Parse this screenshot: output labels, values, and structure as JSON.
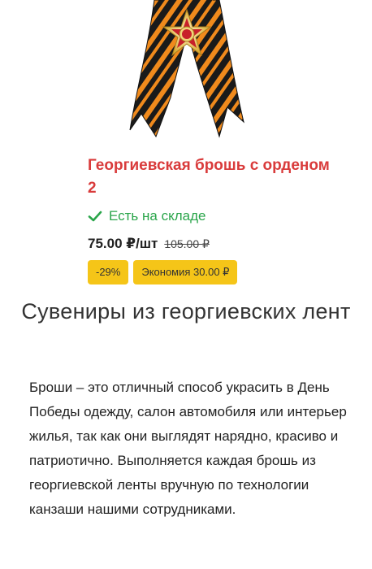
{
  "product": {
    "title": "Георгиевская брошь с орденом 2",
    "stock_status": "Есть на складе",
    "price": "75.00 ₽/шт",
    "old_price": "105.00 ₽",
    "discount_badge": "-29%",
    "savings_badge": "Экономия 30.00 ₽",
    "image_icon": "ribbon-brooch-image"
  },
  "section": {
    "heading": "Сувениры из георгиевских лент",
    "description": "Броши – это отличный способ украсить в День Победы одежду, салон автомобиля или интерьер жилья, так как они выглядят нарядно, красиво и патриотично. Выполняется каждая брошь из георгиевской ленты вручную по технологии канзаши нашими сотрудниками."
  },
  "colors": {
    "title": "#d93b3b",
    "stock": "#2aa54a",
    "badge": "#f5c518",
    "ribbon_orange": "#f08a1c",
    "ribbon_black": "#1a1a1a"
  }
}
